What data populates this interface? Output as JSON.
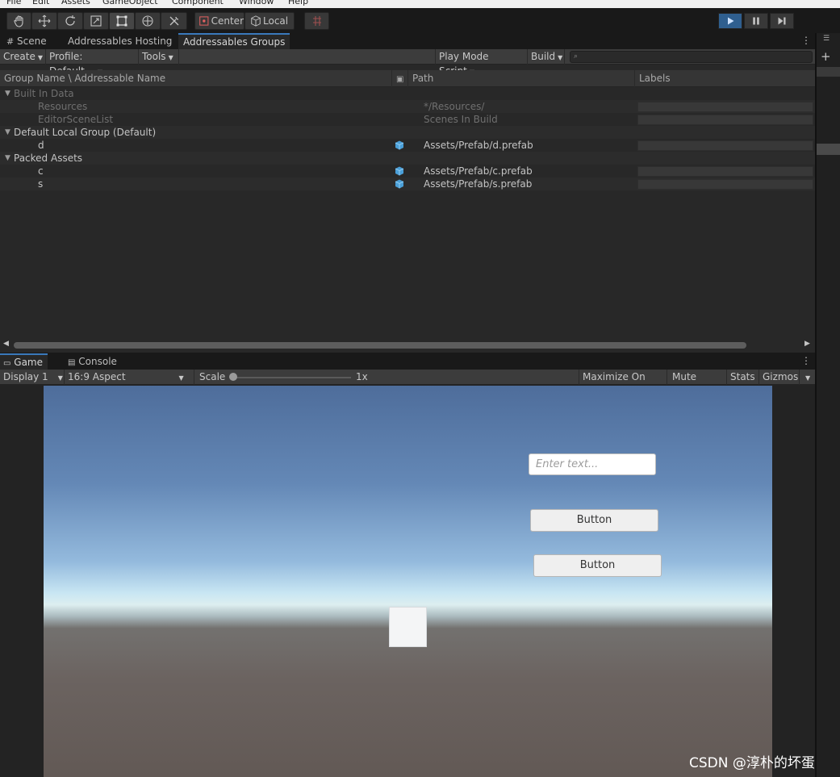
{
  "menu": [
    "File",
    "Edit",
    "Assets",
    "GameObject",
    "Component",
    "Window",
    "Help"
  ],
  "toolbar": {
    "center_label": "Center",
    "local_label": "Local"
  },
  "addressables": {
    "tabs": [
      "Scene",
      "Addressables Hosting",
      "Addressables Groups"
    ],
    "create_label": "Create",
    "profile_label": "Profile: Default",
    "tools_label": "Tools",
    "play_mode_label": "Play Mode Script",
    "build_label": "Build",
    "columns": {
      "name": "Group Name \\ Addressable Name",
      "path": "Path",
      "labels": "Labels"
    },
    "rows": [
      {
        "name": "Built In Data",
        "path": "",
        "level": 0,
        "group": true,
        "dim": true
      },
      {
        "name": "Resources",
        "path": "*/Resources/",
        "level": 1,
        "group": false,
        "dim": true
      },
      {
        "name": "EditorSceneList",
        "path": "Scenes In Build",
        "level": 1,
        "group": false,
        "dim": true
      },
      {
        "name": "Default Local Group (Default)",
        "path": "",
        "level": 0,
        "group": true,
        "dim": false
      },
      {
        "name": "d",
        "path": "Assets/Prefab/d.prefab",
        "level": 1,
        "group": false,
        "dim": false
      },
      {
        "name": "Packed Assets",
        "path": "",
        "level": 0,
        "group": true,
        "dim": false
      },
      {
        "name": "c",
        "path": "Assets/Prefab/c.prefab",
        "level": 1,
        "group": false,
        "dim": false
      },
      {
        "name": "s",
        "path": "Assets/Prefab/s.prefab",
        "level": 1,
        "group": false,
        "dim": false
      }
    ]
  },
  "game": {
    "tabs": [
      "Game",
      "Console"
    ],
    "display_label": "Display 1",
    "aspect_label": "16:9 Aspect",
    "scale_label": "Scale",
    "scale_value": "1x",
    "maximize_label": "Maximize On Play",
    "mute_label": "Mute Audio",
    "stats_label": "Stats",
    "gizmos_label": "Gizmos",
    "input_placeholder": "Enter text...",
    "button1_label": "Button",
    "button2_label": "Button"
  },
  "watermark": "CSDN @淳朴的坏蛋"
}
